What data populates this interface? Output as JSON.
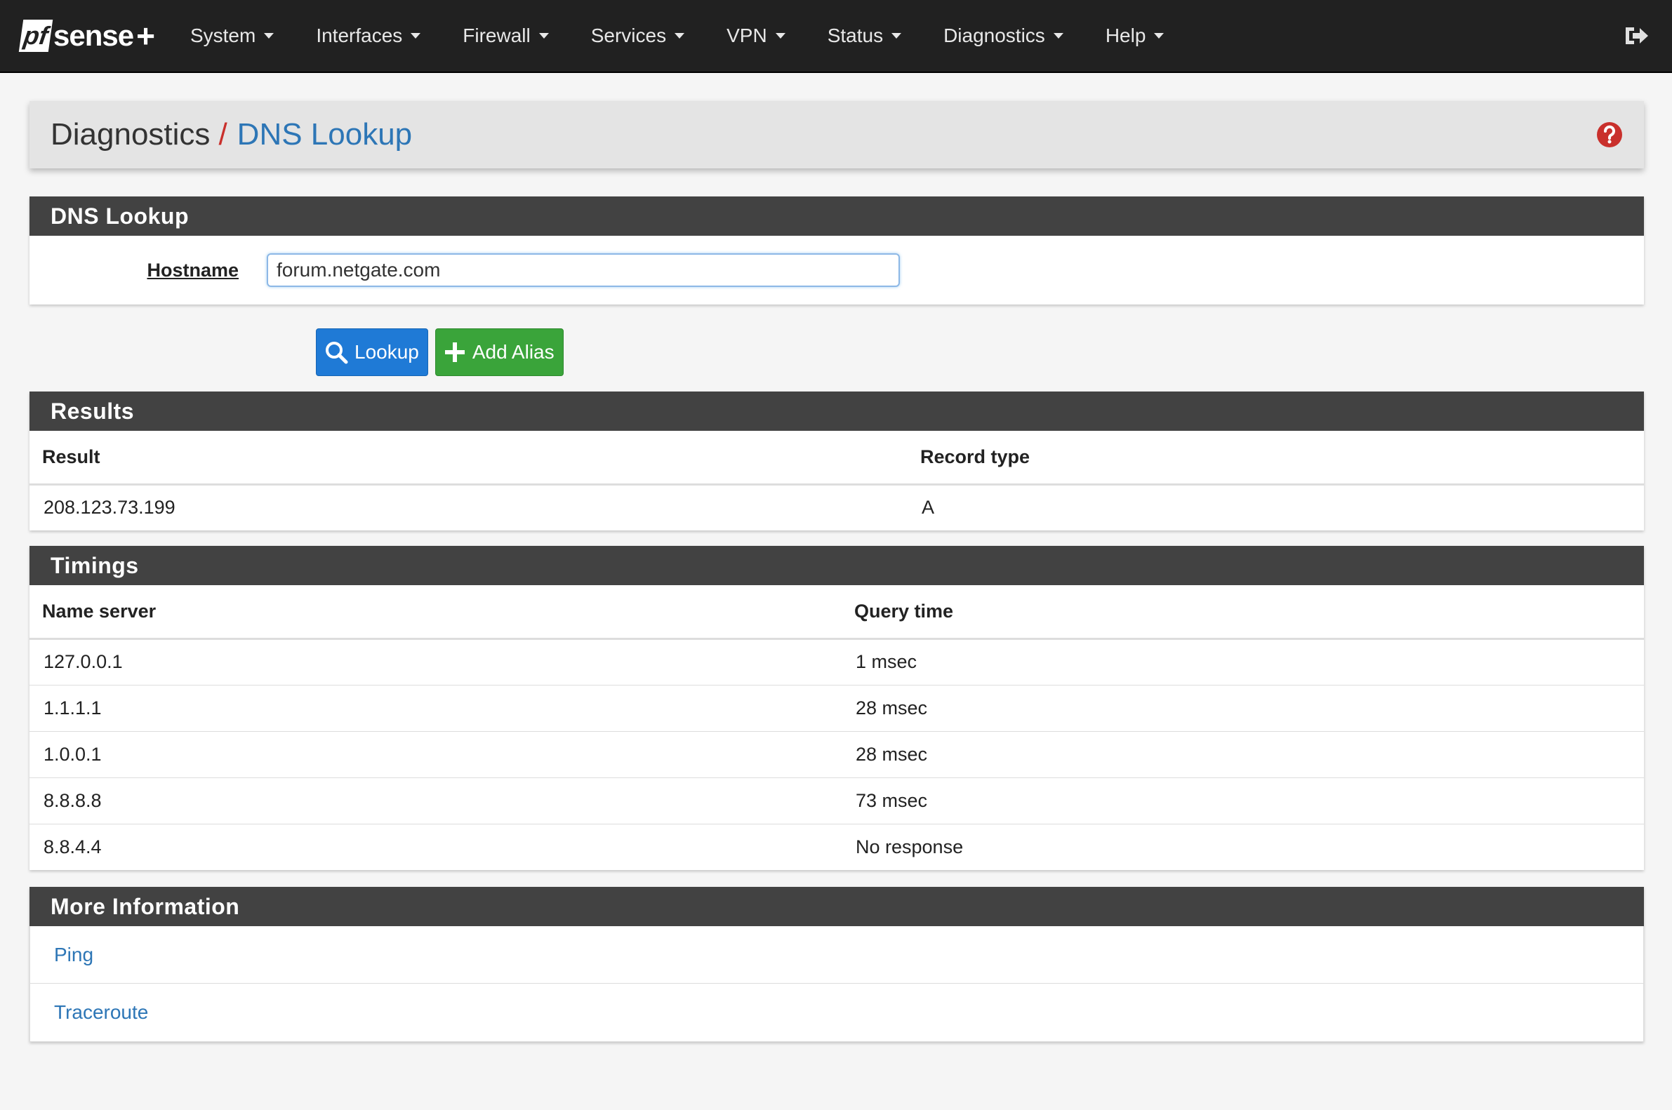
{
  "brand": {
    "pf": "pf",
    "sense": "sense",
    "plus": "+"
  },
  "nav": {
    "items": [
      {
        "label": "System",
        "name": "nav-system"
      },
      {
        "label": "Interfaces",
        "name": "nav-interfaces"
      },
      {
        "label": "Firewall",
        "name": "nav-firewall"
      },
      {
        "label": "Services",
        "name": "nav-services"
      },
      {
        "label": "VPN",
        "name": "nav-vpn"
      },
      {
        "label": "Status",
        "name": "nav-status"
      },
      {
        "label": "Diagnostics",
        "name": "nav-diagnostics"
      },
      {
        "label": "Help",
        "name": "nav-help"
      }
    ],
    "logout_icon": "sign-out-icon"
  },
  "breadcrumb": {
    "root": "Diagnostics",
    "separator": "/",
    "current": "DNS Lookup",
    "help_icon": "question-circle-icon"
  },
  "lookup_panel": {
    "title": "DNS Lookup",
    "hostname_label": "Hostname",
    "hostname_value": "forum.netgate.com"
  },
  "buttons": {
    "lookup": {
      "label": "Lookup",
      "icon": "search-icon"
    },
    "add_alias": {
      "label": "Add Alias",
      "icon": "plus-icon"
    }
  },
  "results": {
    "title": "Results",
    "headers": [
      "Result",
      "Record type"
    ],
    "rows": [
      [
        "208.123.73.199",
        "A"
      ]
    ]
  },
  "timings": {
    "title": "Timings",
    "headers": [
      "Name server",
      "Query time"
    ],
    "rows": [
      [
        "127.0.0.1",
        "1 msec"
      ],
      [
        "1.1.1.1",
        "28 msec"
      ],
      [
        "1.0.0.1",
        "28 msec"
      ],
      [
        "8.8.8.8",
        "73 msec"
      ],
      [
        "8.8.4.4",
        "No response"
      ]
    ]
  },
  "more_info": {
    "title": "More Information",
    "links": [
      "Ping",
      "Traceroute"
    ]
  },
  "colors": {
    "navbar": "#212121",
    "panel_heading": "#424242",
    "link": "#2d76b6",
    "primary": "#1f7ad6",
    "success": "#3aa43a",
    "help": "#c9302c"
  }
}
